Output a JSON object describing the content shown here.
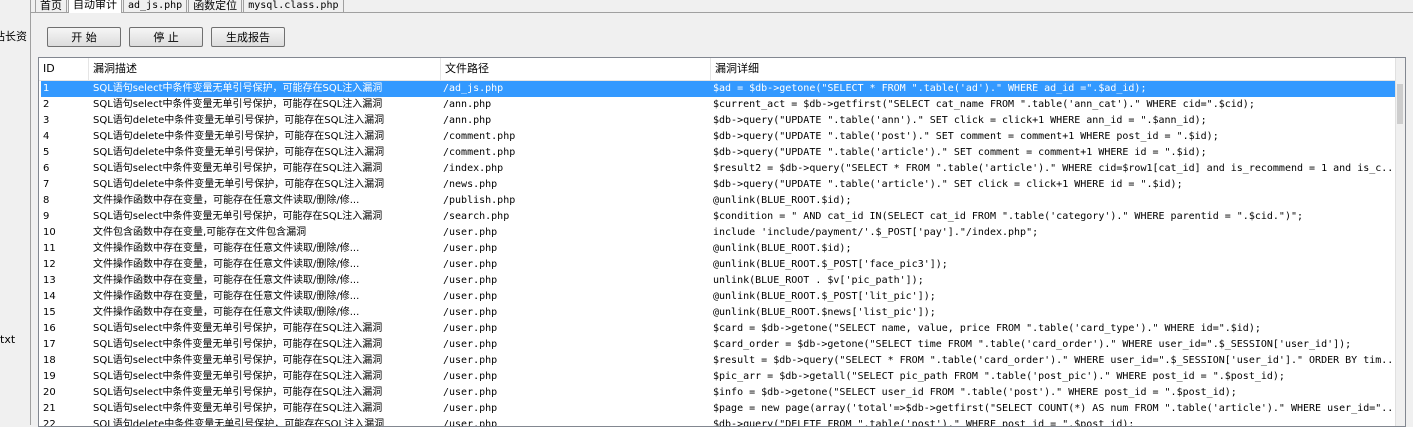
{
  "left_fragments": {
    "top_label": "站长资",
    "bottom_label": "txt"
  },
  "tabs": [
    {
      "label": "首页",
      "mono": false,
      "active": false
    },
    {
      "label": "自动审计",
      "mono": false,
      "active": true
    },
    {
      "label": "ad_js.php",
      "mono": true,
      "active": false
    },
    {
      "label": "函数定位",
      "mono": false,
      "active": false
    },
    {
      "label": "mysql.class.php",
      "mono": true,
      "active": false
    }
  ],
  "toolbar": {
    "start_label": "开 始",
    "stop_label": "停 止",
    "report_label": "生成报告"
  },
  "columns": [
    "ID",
    "漏洞描述",
    "文件路径",
    "漏洞详细"
  ],
  "selected_row": 0,
  "rows": [
    {
      "id": "1",
      "desc": "SQL语句select中条件变量无单引号保护，可能存在SQL注入漏洞",
      "path": "/ad_js.php",
      "detail": "$ad = $db->getone(\"SELECT * FROM \".table('ad').\" WHERE ad_id =\".$ad_id);"
    },
    {
      "id": "2",
      "desc": "SQL语句select中条件变量无单引号保护，可能存在SQL注入漏洞",
      "path": "/ann.php",
      "detail": "$current_act = $db->getfirst(\"SELECT cat_name FROM \".table('ann_cat').\" WHERE cid=\".$cid);"
    },
    {
      "id": "3",
      "desc": "SQL语句delete中条件变量无单引号保护，可能存在SQL注入漏洞",
      "path": "/ann.php",
      "detail": "$db->query(\"UPDATE \".table('ann').\" SET click = click+1 WHERE ann_id = \".$ann_id);"
    },
    {
      "id": "4",
      "desc": "SQL语句delete中条件变量无单引号保护，可能存在SQL注入漏洞",
      "path": "/comment.php",
      "detail": "$db->query(\"UPDATE \".table('post').\" SET comment = comment+1 WHERE post_id = \".$id);"
    },
    {
      "id": "5",
      "desc": "SQL语句delete中条件变量无单引号保护，可能存在SQL注入漏洞",
      "path": "/comment.php",
      "detail": "$db->query(\"UPDATE \".table('article').\" SET comment = comment+1 WHERE id = \".$id);"
    },
    {
      "id": "6",
      "desc": "SQL语句select中条件变量无单引号保护，可能存在SQL注入漏洞",
      "path": "/index.php",
      "detail": "$result2 = $db->query(\"SELECT * FROM \".table('article').\" WHERE cid=$row1[cat_id] and is_recommend = 1 and is_c..."
    },
    {
      "id": "7",
      "desc": "SQL语句delete中条件变量无单引号保护，可能存在SQL注入漏洞",
      "path": "/news.php",
      "detail": "$db->query(\"UPDATE \".table('article').\" SET click = click+1 WHERE id = \".$id);"
    },
    {
      "id": "8",
      "desc": "文件操作函数中存在变量，可能存在任意文件读取/删除/修...",
      "path": "/publish.php",
      "detail": "@unlink(BLUE_ROOT.$id);"
    },
    {
      "id": "9",
      "desc": "SQL语句select中条件变量无单引号保护，可能存在SQL注入漏洞",
      "path": "/search.php",
      "detail": "$condition = \" AND cat_id IN(SELECT cat_id FROM \".table('category').\" WHERE parentid = \".$cid.\")\";"
    },
    {
      "id": "10",
      "desc": "文件包含函数中存在变量,可能存在文件包含漏洞",
      "path": "/user.php",
      "detail": "include 'include/payment/'.$_POST['pay'].\"/index.php\";"
    },
    {
      "id": "11",
      "desc": "文件操作函数中存在变量，可能存在任意文件读取/删除/修...",
      "path": "/user.php",
      "detail": "@unlink(BLUE_ROOT.$id);"
    },
    {
      "id": "12",
      "desc": "文件操作函数中存在变量，可能存在任意文件读取/删除/修...",
      "path": "/user.php",
      "detail": "@unlink(BLUE_ROOT.$_POST['face_pic3']);"
    },
    {
      "id": "13",
      "desc": "文件操作函数中存在变量，可能存在任意文件读取/删除/修...",
      "path": "/user.php",
      "detail": "unlink(BLUE_ROOT . $v['pic_path']);"
    },
    {
      "id": "14",
      "desc": "文件操作函数中存在变量，可能存在任意文件读取/删除/修...",
      "path": "/user.php",
      "detail": "@unlink(BLUE_ROOT.$_POST['lit_pic']);"
    },
    {
      "id": "15",
      "desc": "文件操作函数中存在变量，可能存在任意文件读取/删除/修...",
      "path": "/user.php",
      "detail": "@unlink(BLUE_ROOT.$news['list_pic']);"
    },
    {
      "id": "16",
      "desc": "SQL语句select中条件变量无单引号保护，可能存在SQL注入漏洞",
      "path": "/user.php",
      "detail": "$card = $db->getone(\"SELECT name, value, price FROM \".table('card_type').\" WHERE id=\".$id);"
    },
    {
      "id": "17",
      "desc": "SQL语句select中条件变量无单引号保护，可能存在SQL注入漏洞",
      "path": "/user.php",
      "detail": "$card_order = $db->getone(\"SELECT time FROM \".table('card_order').\" WHERE user_id=\".$_SESSION['user_id']);"
    },
    {
      "id": "18",
      "desc": "SQL语句select中条件变量无单引号保护，可能存在SQL注入漏洞",
      "path": "/user.php",
      "detail": "$result = $db->query(\"SELECT * FROM \".table('card_order').\" WHERE user_id=\".$_SESSION['user_id'].\" ORDER BY tim..."
    },
    {
      "id": "19",
      "desc": "SQL语句select中条件变量无单引号保护，可能存在SQL注入漏洞",
      "path": "/user.php",
      "detail": "$pic_arr = $db->getall(\"SELECT pic_path FROM \".table('post_pic').\" WHERE post_id = \".$post_id);"
    },
    {
      "id": "20",
      "desc": "SQL语句select中条件变量无单引号保护，可能存在SQL注入漏洞",
      "path": "/user.php",
      "detail": "$info = $db->getone(\"SELECT user_id FROM \".table('post').\" WHERE post_id = \".$post_id);"
    },
    {
      "id": "21",
      "desc": "SQL语句select中条件变量无单引号保护，可能存在SQL注入漏洞",
      "path": "/user.php",
      "detail": "$page = new page(array('total'=>$db->getfirst(\"SELECT COUNT(*) AS num FROM \".table('article').\" WHERE user_id=\"..."
    },
    {
      "id": "22",
      "desc": "SQL语句delete中条件变量无单引号保护，可能存在SQL注入漏洞",
      "path": "/user.php",
      "detail": "$db->query(\"DELETE FROM \".table('post').\" WHERE post_id = \".$post_id);"
    }
  ]
}
